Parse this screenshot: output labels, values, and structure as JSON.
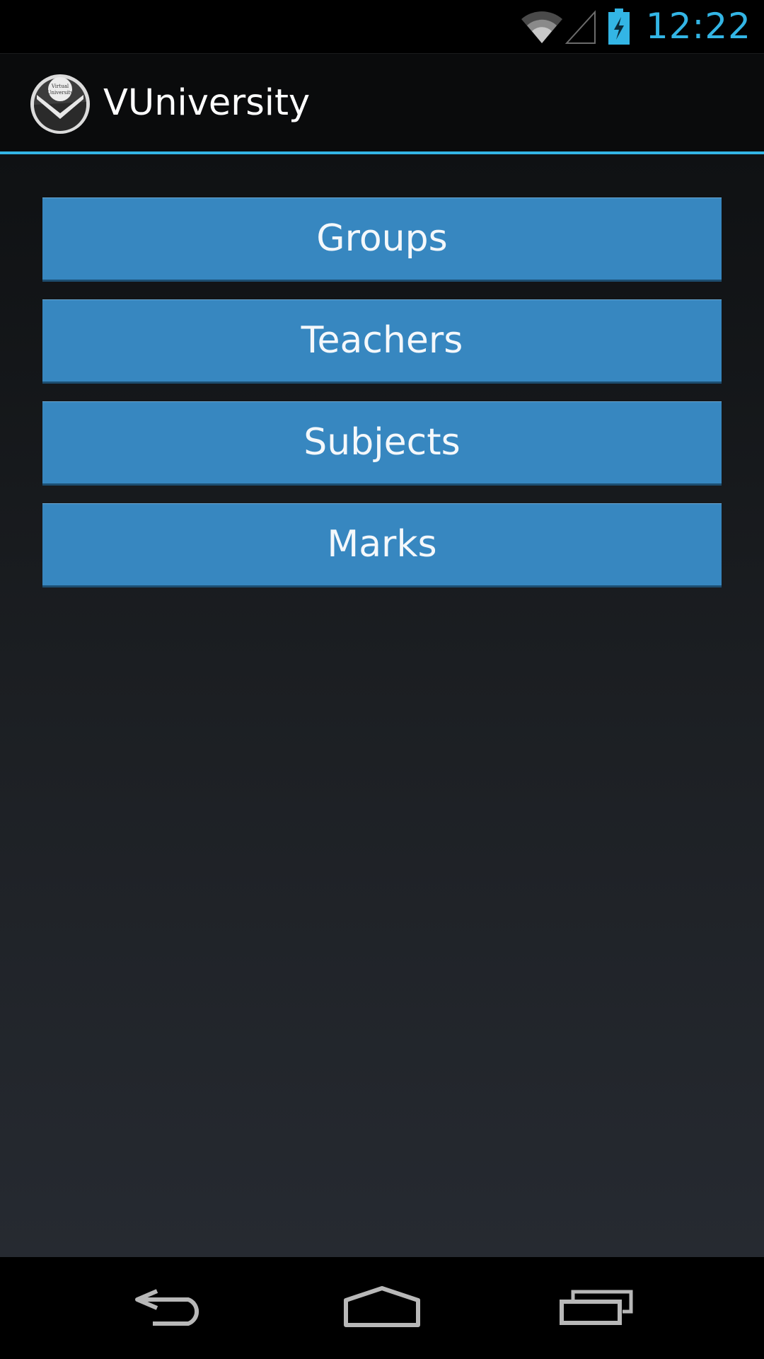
{
  "status_bar": {
    "time": "12:22",
    "icons": [
      "wifi-icon",
      "cell-signal-icon",
      "battery-charging-icon"
    ],
    "accent_color": "#33b5e5"
  },
  "action_bar": {
    "app_title": "VUniversity",
    "app_icon": "app-logo-icon",
    "logo_text_line1": "Virtual",
    "logo_text_line2": "University",
    "accent_color": "#33b5e5"
  },
  "menu": {
    "buttons": [
      {
        "label": "Groups"
      },
      {
        "label": "Teachers"
      },
      {
        "label": "Subjects"
      },
      {
        "label": "Marks"
      }
    ],
    "button_color": "#3787c0"
  },
  "nav_bar": {
    "icons": [
      "back-icon",
      "home-icon",
      "recent-apps-icon"
    ]
  }
}
